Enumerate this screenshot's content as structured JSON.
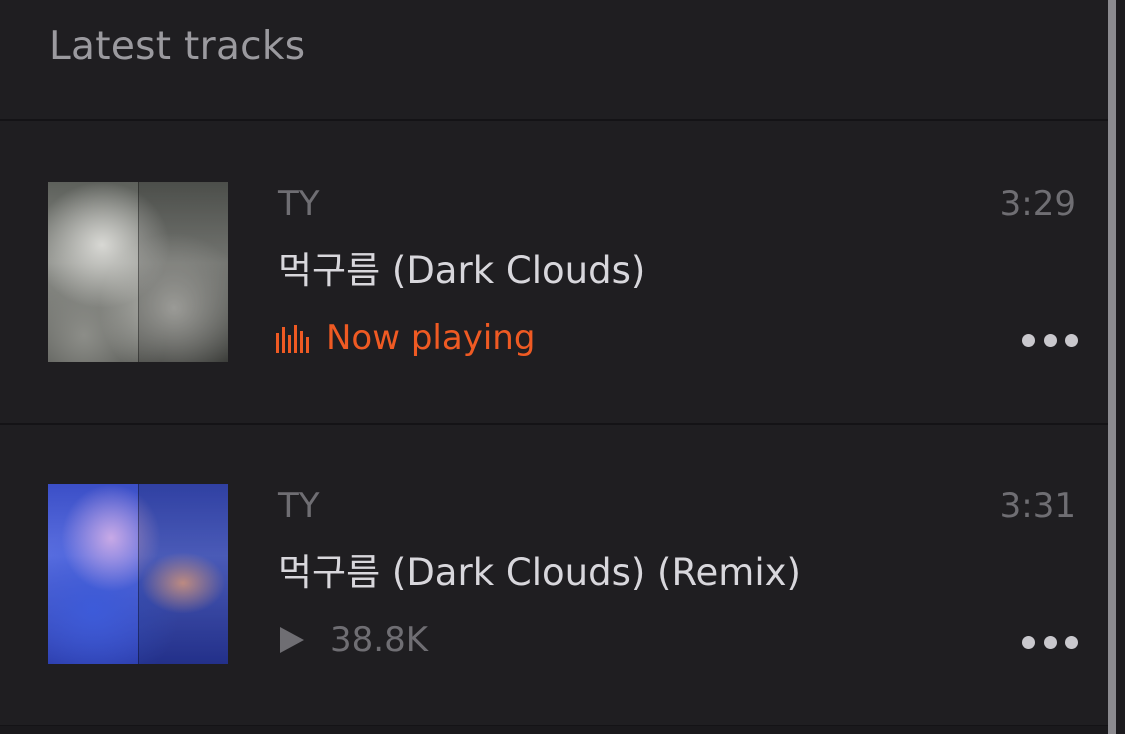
{
  "header": {
    "title": "Latest tracks"
  },
  "tracks": [
    {
      "artist": "TY",
      "title": "먹구름 (Dark Clouds)",
      "duration": "3:29",
      "status": "Now playing",
      "artwork_icon": "cloud-artwork-grey"
    },
    {
      "artist": "TY",
      "title": "먹구름 (Dark Clouds) (Remix)",
      "duration": "3:31",
      "plays": "38.8K",
      "artwork_icon": "cloud-artwork-blue"
    }
  ],
  "colors": {
    "background": "#1f1e21",
    "accent": "#ef5a23",
    "muted_text": "#6f6e73",
    "primary_text": "#d8d7dc"
  },
  "icons": {
    "now_playing": "equalizer-icon",
    "plays": "play-icon",
    "more": "more-options-icon"
  }
}
